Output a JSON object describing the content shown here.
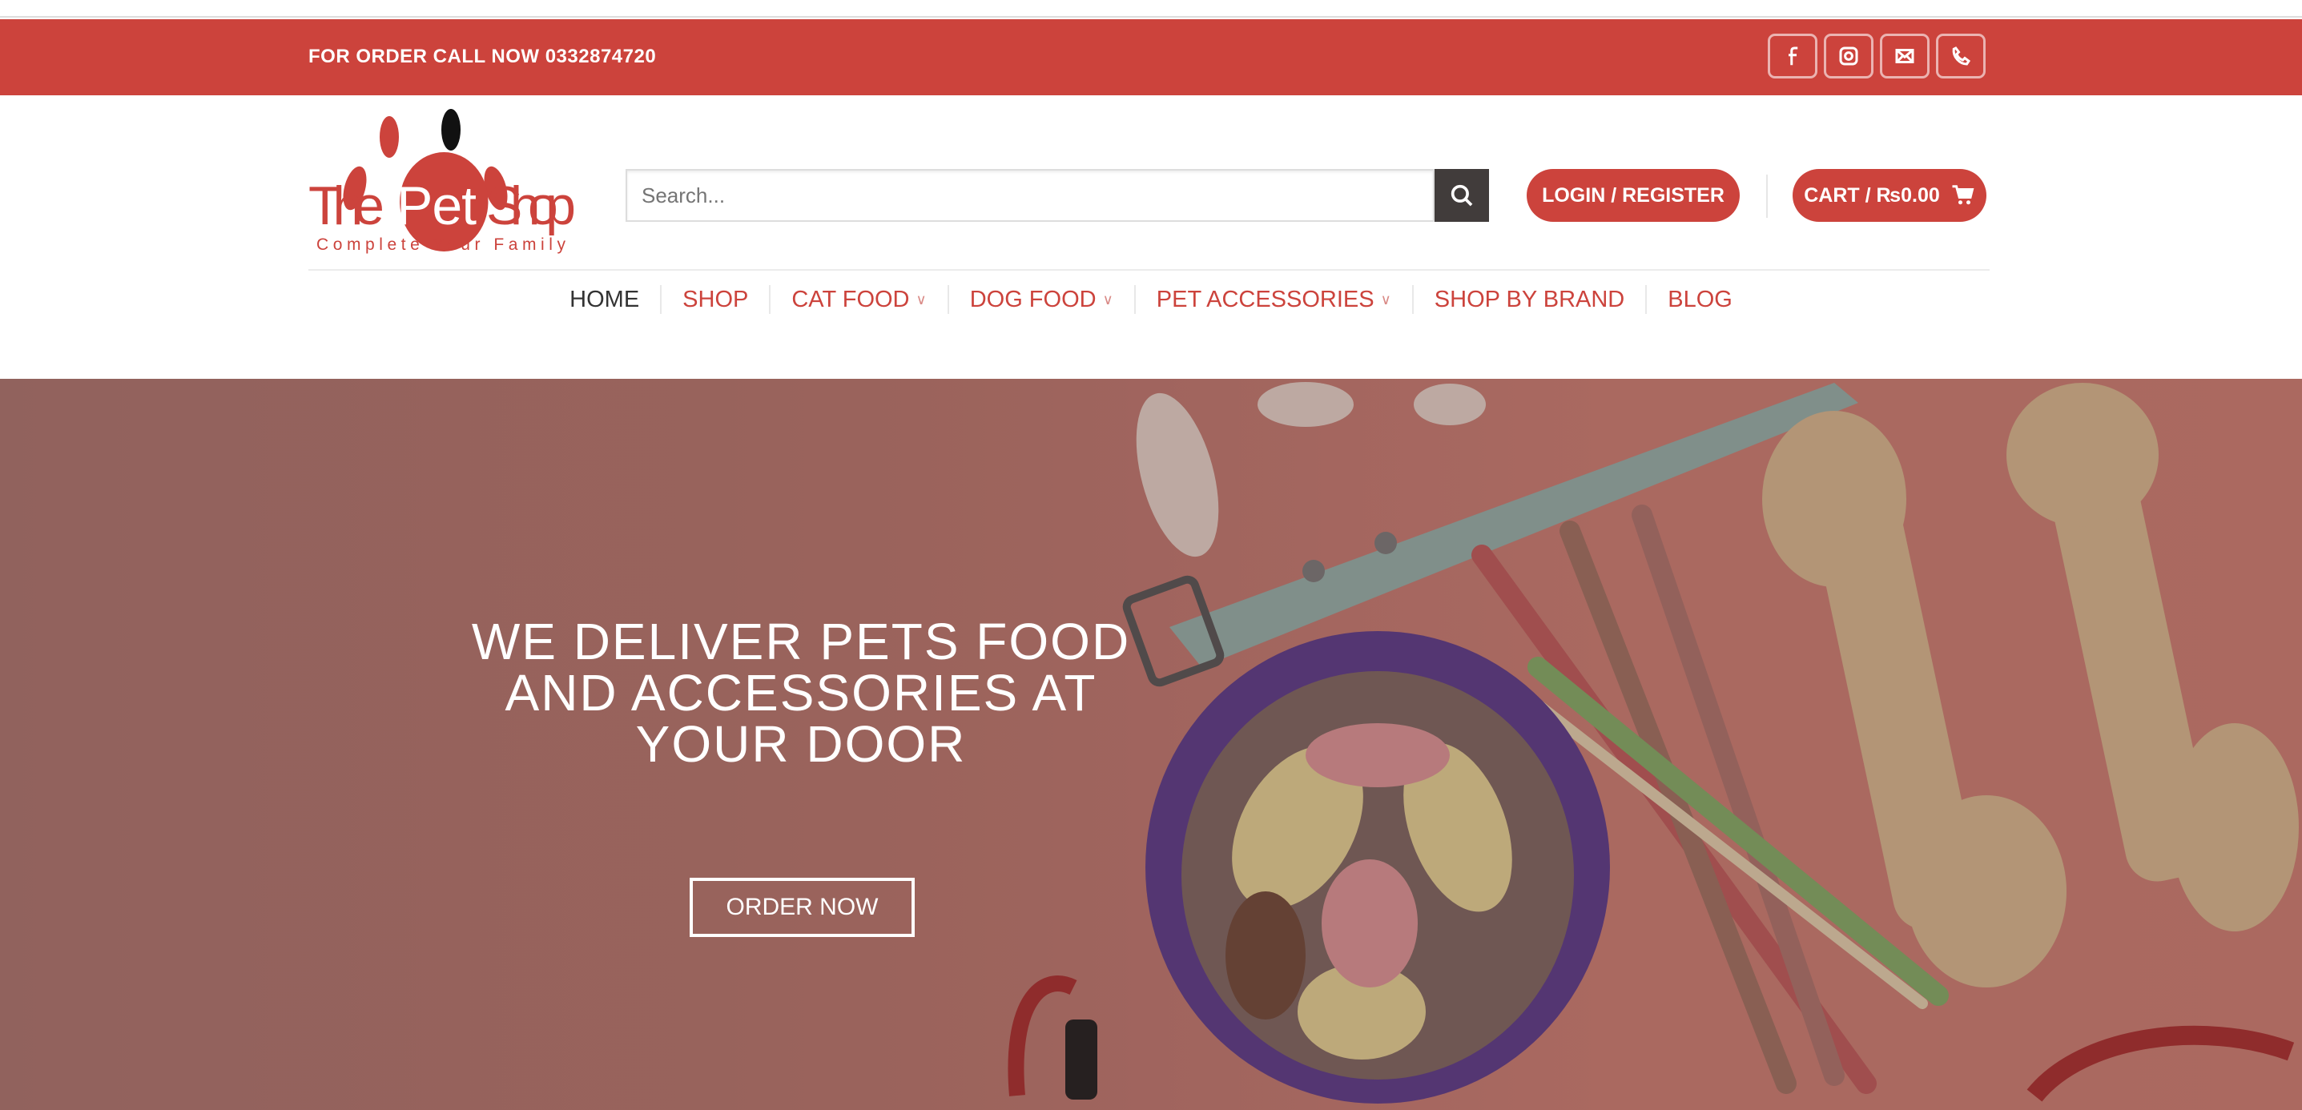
{
  "topbar": {
    "phone_text": "FOR ORDER CALL NOW 0332874720",
    "social_icons": [
      "facebook-icon",
      "instagram-icon",
      "email-icon",
      "phone-icon"
    ]
  },
  "logo": {
    "brand": "The Pet Shop",
    "tagline": "Complete Your Family"
  },
  "search": {
    "placeholder": "Search..."
  },
  "header": {
    "login_label": "LOGIN / REGISTER",
    "cart_label": "CART / ₨0.00"
  },
  "nav": {
    "items": [
      {
        "label": "HOME"
      },
      {
        "label": "SHOP"
      },
      {
        "label": "CAT FOOD"
      },
      {
        "label": "DOG FOOD"
      },
      {
        "label": "PET ACCESSORIES"
      },
      {
        "label": "SHOP BY BRAND"
      },
      {
        "label": "BLOG"
      }
    ]
  },
  "hero": {
    "line1": "WE DELIVER PETS FOOD",
    "line2": "AND ACCESSORIES AT",
    "line3": "YOUR DOOR",
    "button": "ORDER NOW"
  },
  "colors": {
    "brand": "#cc433c",
    "dark": "#413c3b"
  }
}
